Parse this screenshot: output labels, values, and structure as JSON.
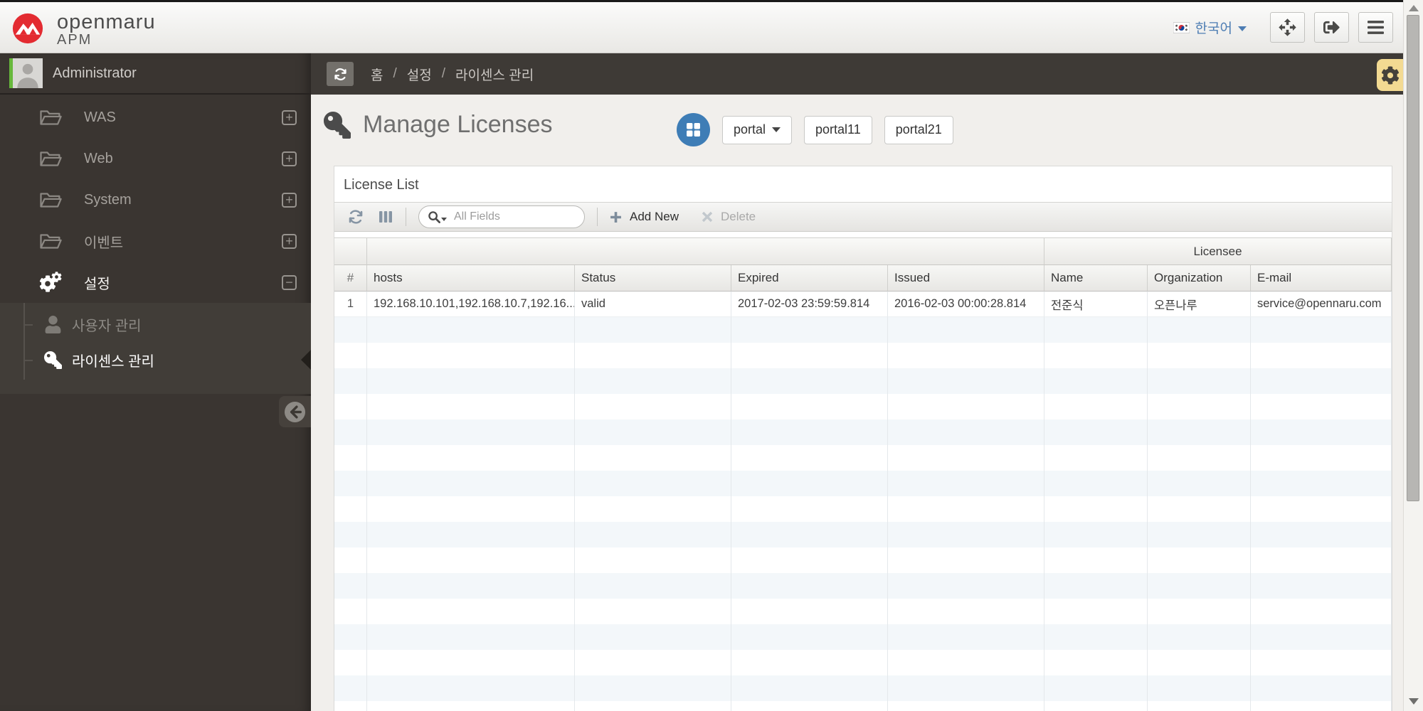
{
  "colors": {
    "brand_red": "#e32b31",
    "accent_blue": "#3e7db6",
    "link_blue": "#4d7db3",
    "sidebar_bg": "#3a3531",
    "breadcrumb_bg": "#3e3a36",
    "gear_button_bg": "#f3da92",
    "row_stripe_blue": "#f3f7fa",
    "avatar_stripe_green": "#67b83c"
  },
  "topbar": {
    "brand": "openmaru",
    "brand_sub": "APM",
    "language": "한국어"
  },
  "breadcrumb": {
    "separator": "/",
    "items": [
      "홈",
      "설정",
      "라이센스 관리"
    ]
  },
  "sidebar": {
    "user": "Administrator",
    "items": [
      {
        "label": "WAS"
      },
      {
        "label": "Web"
      },
      {
        "label": "System"
      },
      {
        "label": "이벤트"
      },
      {
        "label": "설정"
      }
    ],
    "submenu": [
      {
        "label": "사용자 관리"
      },
      {
        "label": "라이센스 관리"
      }
    ]
  },
  "page": {
    "title": "Manage Licenses",
    "portals": [
      {
        "label": "portal"
      },
      {
        "label": "portal11"
      },
      {
        "label": "portal21"
      }
    ]
  },
  "panel": {
    "title": "License List"
  },
  "toolbar": {
    "search_placeholder": "All Fields",
    "add_new": "Add New",
    "delete": "Delete"
  },
  "table": {
    "group_header": "Licensee",
    "columns": [
      "#",
      "hosts",
      "Status",
      "Expired",
      "Issued",
      "Name",
      "Organization",
      "E-mail"
    ],
    "rows": [
      [
        "1",
        "192.168.10.101,192.168.10.7,192.16...",
        "valid",
        "2017-02-03 23:59:59.814",
        "2016-02-03 00:00:28.814",
        "전준식",
        "오픈나루",
        "service@opennaru.com"
      ]
    ]
  }
}
